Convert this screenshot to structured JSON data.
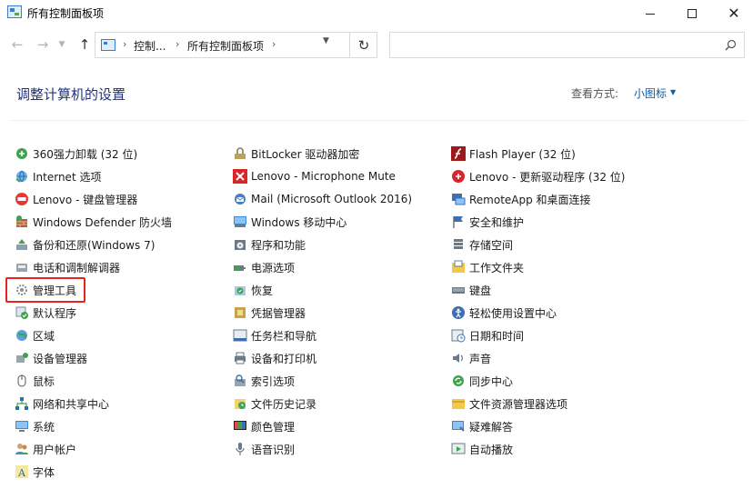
{
  "window": {
    "title": "所有控制面板项",
    "minimize_icon": "minimize-icon",
    "maximize_icon": "maximize-icon",
    "close_icon": "close-icon"
  },
  "navigation": {
    "breadcrumb": [
      "控制...",
      "所有控制面板项"
    ],
    "search_placeholder": ""
  },
  "header": {
    "title": "调整计算机的设置",
    "view_by_label": "查看方式:",
    "view_by_value": "小图标"
  },
  "columns": [
    [
      {
        "label": "360强力卸载 (32 位)",
        "icon": "uninstall-icon"
      },
      {
        "label": "Internet 选项",
        "icon": "internet-options-icon"
      },
      {
        "label": "Lenovo - 键盘管理器",
        "icon": "lenovo-keyboard-icon"
      },
      {
        "label": "Windows Defender 防火墙",
        "icon": "firewall-icon"
      },
      {
        "label": "备份和还原(Windows 7)",
        "icon": "backup-icon"
      },
      {
        "label": "电话和调制解调器",
        "icon": "phone-modem-icon"
      },
      {
        "label": "管理工具",
        "icon": "admin-tools-icon"
      },
      {
        "label": "默认程序",
        "icon": "default-programs-icon"
      },
      {
        "label": "区域",
        "icon": "region-icon"
      },
      {
        "label": "设备管理器",
        "icon": "device-manager-icon"
      },
      {
        "label": "鼠标",
        "icon": "mouse-icon"
      },
      {
        "label": "网络和共享中心",
        "icon": "network-icon"
      },
      {
        "label": "系统",
        "icon": "system-icon"
      },
      {
        "label": "用户帐户",
        "icon": "user-accounts-icon"
      },
      {
        "label": "字体",
        "icon": "fonts-icon"
      }
    ],
    [
      {
        "label": "BitLocker 驱动器加密",
        "icon": "bitlocker-icon"
      },
      {
        "label": "Lenovo - Microphone Mute",
        "icon": "microphone-mute-icon"
      },
      {
        "label": "Mail (Microsoft Outlook 2016)",
        "icon": "mail-icon"
      },
      {
        "label": "Windows 移动中心",
        "icon": "mobility-center-icon"
      },
      {
        "label": "程序和功能",
        "icon": "programs-features-icon"
      },
      {
        "label": "电源选项",
        "icon": "power-options-icon"
      },
      {
        "label": "恢复",
        "icon": "recovery-icon"
      },
      {
        "label": "凭据管理器",
        "icon": "credential-manager-icon"
      },
      {
        "label": "任务栏和导航",
        "icon": "taskbar-icon"
      },
      {
        "label": "设备和打印机",
        "icon": "printer-icon"
      },
      {
        "label": "索引选项",
        "icon": "indexing-icon"
      },
      {
        "label": "文件历史记录",
        "icon": "file-history-icon"
      },
      {
        "label": "颜色管理",
        "icon": "color-management-icon"
      },
      {
        "label": "语音识别",
        "icon": "speech-recognition-icon"
      }
    ],
    [
      {
        "label": "Flash Player (32 位)",
        "icon": "flash-icon"
      },
      {
        "label": "Lenovo - 更新驱动程序 (32 位)",
        "icon": "lenovo-update-icon"
      },
      {
        "label": "RemoteApp 和桌面连接",
        "icon": "remoteapp-icon"
      },
      {
        "label": "安全和维护",
        "icon": "security-flag-icon"
      },
      {
        "label": "存储空间",
        "icon": "storage-spaces-icon"
      },
      {
        "label": "工作文件夹",
        "icon": "work-folders-icon"
      },
      {
        "label": "键盘",
        "icon": "keyboard-icon"
      },
      {
        "label": "轻松使用设置中心",
        "icon": "ease-of-access-icon"
      },
      {
        "label": "日期和时间",
        "icon": "date-time-icon"
      },
      {
        "label": "声音",
        "icon": "sound-icon"
      },
      {
        "label": "同步中心",
        "icon": "sync-center-icon"
      },
      {
        "label": "文件资源管理器选项",
        "icon": "explorer-options-icon"
      },
      {
        "label": "疑难解答",
        "icon": "troubleshooting-icon"
      },
      {
        "label": "自动播放",
        "icon": "autoplay-icon"
      }
    ]
  ],
  "highlighted_item": "管理工具",
  "colors": {
    "title_blue": "#1e3287",
    "link_blue": "#0b5cad",
    "highlight_red": "#e8221d"
  }
}
